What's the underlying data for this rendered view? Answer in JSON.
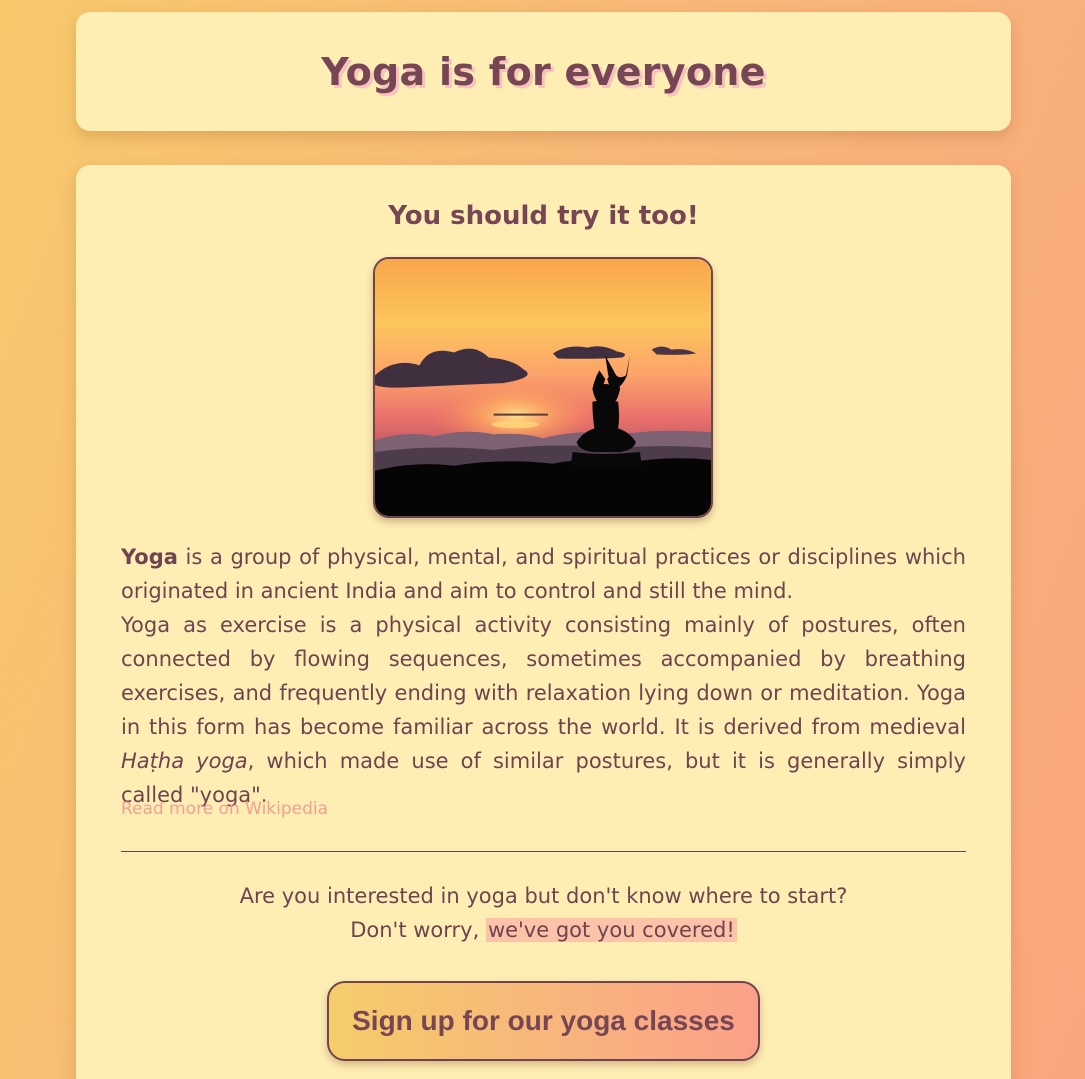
{
  "header": {
    "title": "Yoga is for everyone"
  },
  "main": {
    "subtitle": "You should try it too!",
    "hero_image": {
      "alt": "Silhouette of a person meditating at sunset"
    },
    "intro": {
      "bold_word": "Yoga",
      "text": " is a group of physical, mental, and spiritual practices or disciplines which originated in ancient India and aim to control and still the mind."
    },
    "exercise": {
      "text_before": "Yoga as exercise is a physical activity consisting mainly of postures, often connected by flowing sequences, sometimes accompanied by breathing exercises, and frequently ending with relaxation lying down or meditation. Yoga in this form has become familiar across the world. It is derived from medieval ",
      "italic_term": "Haṭha yoga",
      "text_after": ", which made use of similar postures, but it is generally simply called \"yoga\"."
    },
    "wiki_link": "Read more on Wikipedia",
    "cta": {
      "line1": "Are you interested in yoga but don't know where to start?",
      "line2_prefix": "Don't worry, ",
      "line2_highlight": "we've got you covered!"
    },
    "signup_button": "Sign up for our yoga classes"
  },
  "colors": {
    "background_start": "#f7c96b",
    "background_end": "#f9a67c",
    "card": "#feeeb4",
    "text": "#6e4451",
    "link": "#f39f93",
    "highlight": "#fcc3a8"
  }
}
